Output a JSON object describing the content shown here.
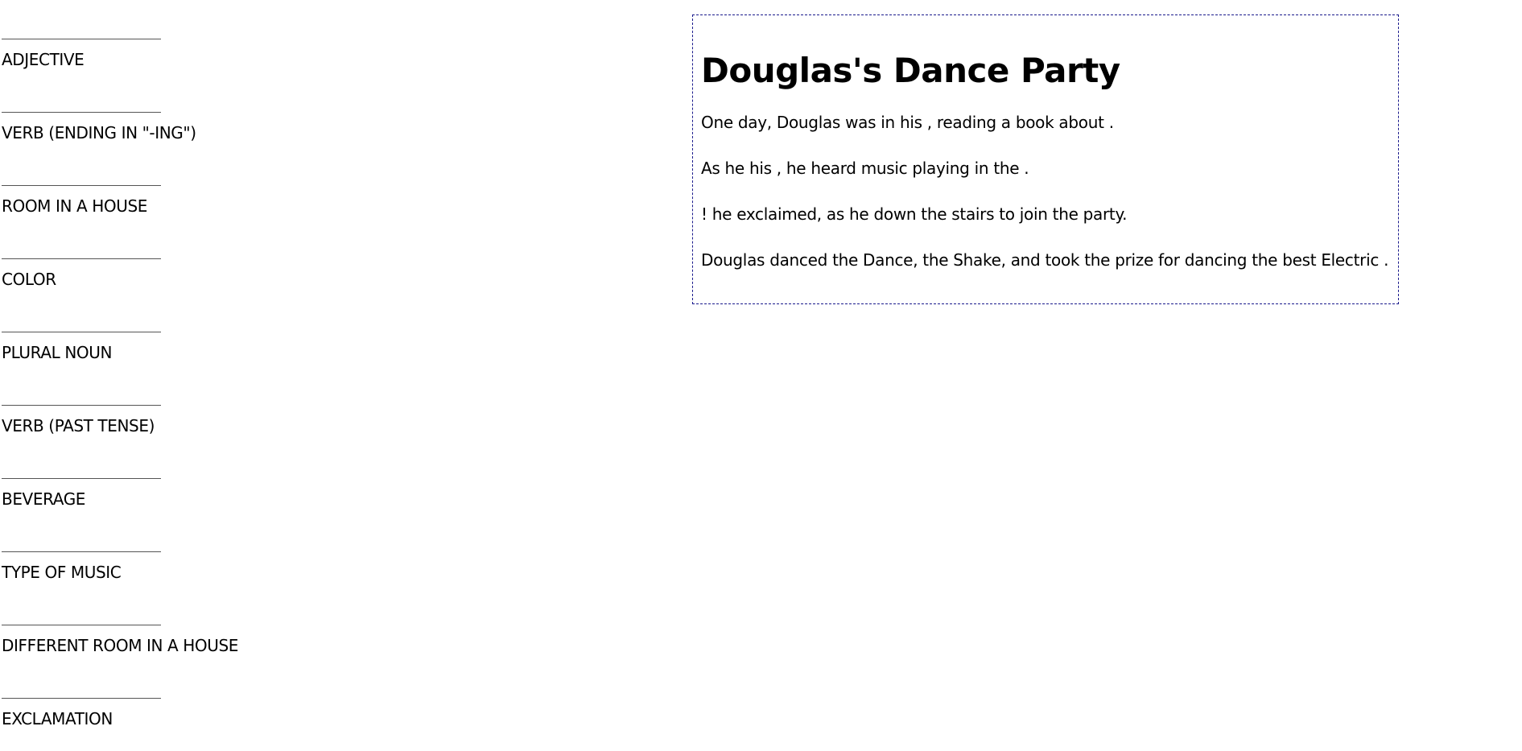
{
  "blanks": [
    {
      "label": "ADJECTIVE"
    },
    {
      "label": "VERB (ENDING IN \"-ING\")"
    },
    {
      "label": "ROOM IN A HOUSE"
    },
    {
      "label": "COLOR"
    },
    {
      "label": "PLURAL NOUN"
    },
    {
      "label": "VERB (PAST TENSE)"
    },
    {
      "label": "BEVERAGE"
    },
    {
      "label": "TYPE OF MUSIC"
    },
    {
      "label": "DIFFERENT ROOM IN A HOUSE"
    },
    {
      "label": "EXCLAMATION"
    }
  ],
  "story": {
    "title": "Douglas's Dance Party",
    "paragraphs": [
      "One day, Douglas was in his , reading a book about .",
      "As he his , he heard music playing in the .",
      "! he exclaimed, as he down the stairs to join the party.",
      "Douglas danced the Dance, the Shake, and took the prize for dancing the best Electric ."
    ]
  },
  "colors": {
    "story_border": "#1a1a8c",
    "blank_line": "#555555"
  }
}
